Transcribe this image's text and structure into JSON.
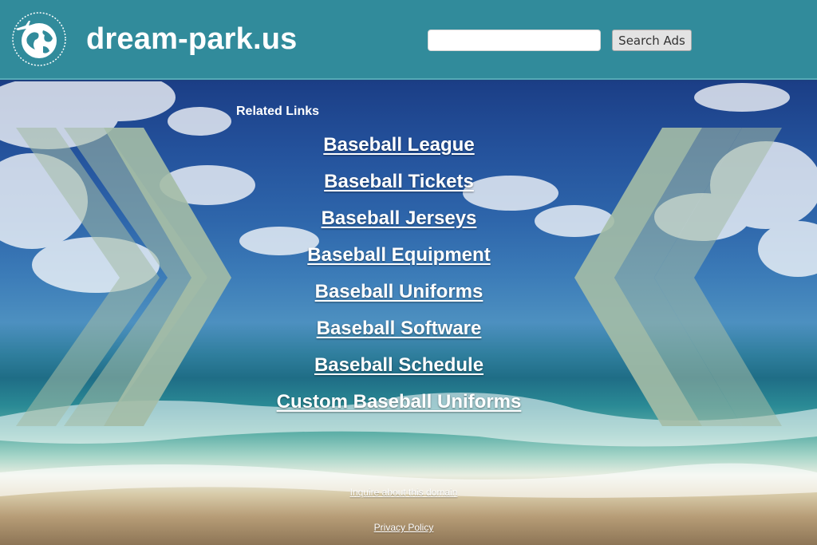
{
  "header": {
    "site_title": "dream-park.us",
    "logo_icon": "globe-airplane-icon",
    "search_value": "",
    "search_button_label": "Search Ads"
  },
  "main": {
    "related_label": "Related Links",
    "links": [
      "Baseball League",
      "Baseball Tickets",
      "Baseball Jerseys",
      "Baseball Equipment",
      "Baseball Uniforms",
      "Baseball Software",
      "Baseball Schedule",
      "Custom Baseball Uniforms"
    ]
  },
  "footer": {
    "inquire_label": "Inquire about this domain",
    "privacy_label": "Privacy Policy"
  },
  "colors": {
    "header_bg": "#318b9b",
    "text": "#ffffff",
    "chevron": "#9fb8a4"
  }
}
